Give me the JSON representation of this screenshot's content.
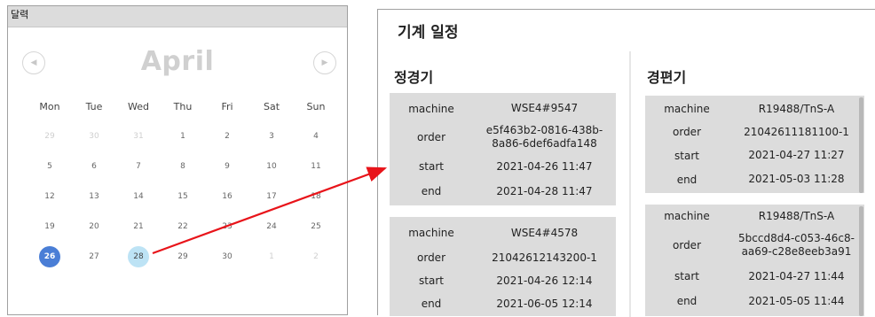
{
  "calendar": {
    "panel_title": "달력",
    "month": "April",
    "prev_icon": "chevron-left-icon",
    "next_icon": "chevron-right-icon",
    "weekdays": [
      "Mon",
      "Tue",
      "Wed",
      "Thu",
      "Fri",
      "Sat",
      "Sun"
    ],
    "weeks": [
      [
        "29",
        "30",
        "31",
        "1",
        "2",
        "3",
        "4"
      ],
      [
        "5",
        "6",
        "7",
        "8",
        "9",
        "10",
        "11"
      ],
      [
        "12",
        "13",
        "14",
        "15",
        "16",
        "17",
        "18"
      ],
      [
        "19",
        "20",
        "21",
        "22",
        "23",
        "24",
        "25"
      ],
      [
        "26",
        "27",
        "28",
        "29",
        "30",
        "1",
        "2"
      ]
    ],
    "today_day": "26",
    "selected_day": "28",
    "colors": {
      "today": "#4a7ed6",
      "selected": "#bde3f5"
    }
  },
  "schedule": {
    "title": "기계 일정",
    "left_column": {
      "title": "정경기",
      "cards": [
        {
          "machine_label": "machine",
          "machine": "WSE4#9547",
          "order_label": "order",
          "order_line1": "e5f463b2-0816-438b-",
          "order_line2": "8a86-6def6adfa148",
          "start_label": "start",
          "start": "2021-04-26 11:47",
          "end_label": "end",
          "end": "2021-04-28 11:47"
        },
        {
          "machine_label": "machine",
          "machine": "WSE4#4578",
          "order_label": "order",
          "order_line1": "21042612143200-1",
          "order_line2": "",
          "start_label": "start",
          "start": "2021-04-26 12:14",
          "end_label": "end",
          "end": "2021-06-05 12:14"
        }
      ]
    },
    "right_column": {
      "title": "경편기",
      "cards": [
        {
          "machine_label": "machine",
          "machine": "R19488/TnS-A",
          "order_label": "order",
          "order_line1": "21042611181100-1",
          "order_line2": "",
          "start_label": "start",
          "start": "2021-04-27 11:27",
          "end_label": "end",
          "end": "2021-05-03 11:28"
        },
        {
          "machine_label": "machine",
          "machine": "R19488/TnS-A",
          "order_label": "order",
          "order_line1": "5bccd8d4-c053-46c8-",
          "order_line2": "aa69-c28e8eeb3a91",
          "start_label": "start",
          "start": "2021-04-27 11:44",
          "end_label": "end",
          "end": "2021-05-05 11:44"
        }
      ]
    }
  },
  "annotation": {
    "arrow_color": "#e8141a"
  }
}
